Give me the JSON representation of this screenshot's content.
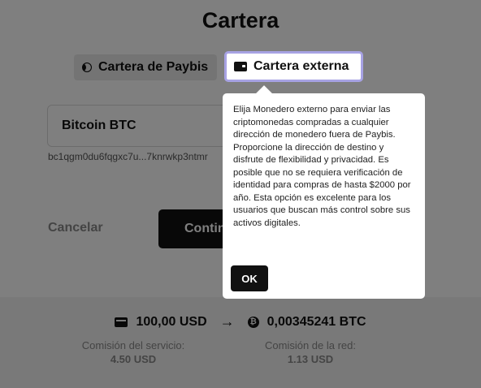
{
  "page": {
    "title": "Cartera"
  },
  "tabs": {
    "paybis_label": "Cartera de Paybis",
    "external_label": "Cartera externa"
  },
  "form": {
    "currency_value": "Bitcoin BTC",
    "address_value": "bc1qgm0du6fqgxc7u...7knrwkp3ntmr",
    "cancel_label": "Cancelar",
    "continue_label": "Continuar"
  },
  "summary": {
    "from_amount": "100,00 USD",
    "to_amount": "0,00345241 BTC",
    "service_fee_label": "Comisión del servicio:",
    "service_fee_value": "4.50 USD",
    "network_fee_label": "Comisión de la red:",
    "network_fee_value": "1.13 USD"
  },
  "tooltip": {
    "text": "Elija Monedero externo para enviar las criptomonedas compradas a cualquier dirección de monedero fuera de Paybis. Proporcione la dirección de destino y disfrute de flexibilidad y privacidad. Es posible que no se requiera verificación de identidad para compras de hasta $2000 por año. Esta opción es excelente para los usuarios que buscan más control sobre sus activos digitales.",
    "ok_label": "OK"
  },
  "icons": {
    "paybis_tab": "half-moon-icon",
    "external_tab": "wallet-icon",
    "from_currency": "card-icon",
    "arrow": "arrow-right-icon",
    "to_currency": "bitcoin-icon"
  },
  "colors": {
    "accent_border": "#a7a2e3",
    "primary_button": "#111111",
    "overlay": "rgba(0,0,0,0.5)"
  }
}
